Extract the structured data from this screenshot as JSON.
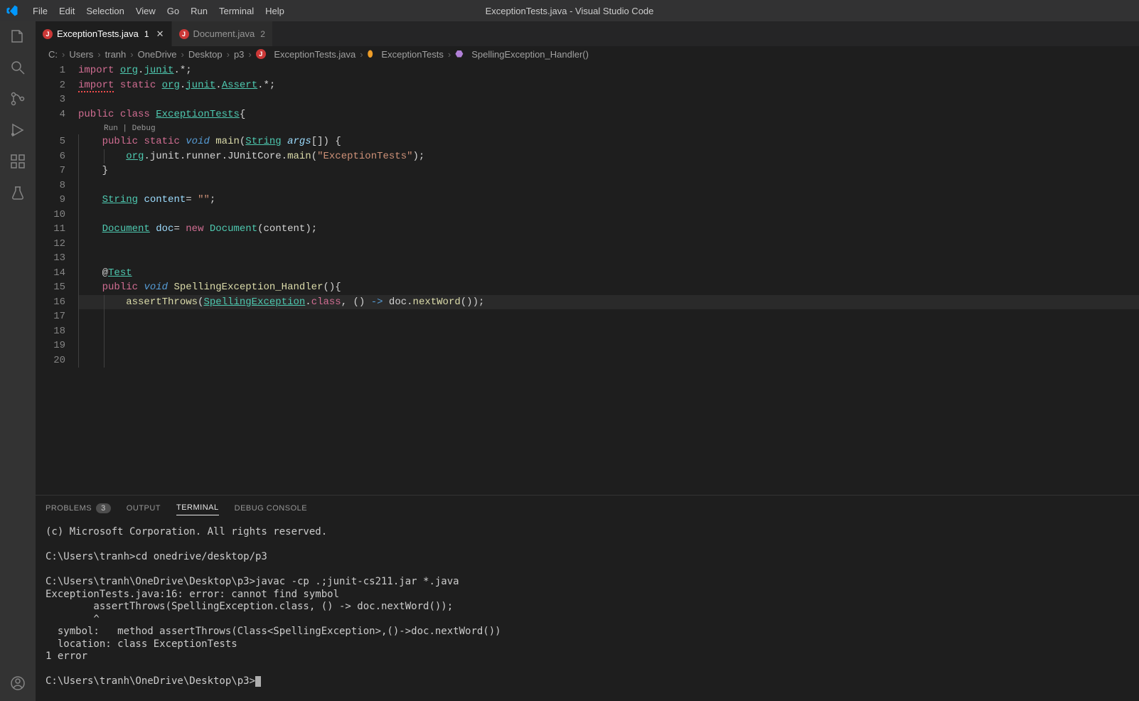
{
  "window": {
    "title": "ExceptionTests.java - Visual Studio Code"
  },
  "menu": {
    "items": [
      "File",
      "Edit",
      "Selection",
      "View",
      "Go",
      "Run",
      "Terminal",
      "Help"
    ]
  },
  "tabs": [
    {
      "label": "ExceptionTests.java",
      "modified": "1",
      "active": true,
      "close": true
    },
    {
      "label": "Document.java",
      "modified": "2",
      "active": false,
      "close": false
    }
  ],
  "breadcrumbs": {
    "parts": [
      "C:",
      "Users",
      "tranh",
      "OneDrive",
      "Desktop",
      "p3"
    ],
    "file": "ExceptionTests.java",
    "class": "ExceptionTests",
    "method": "SpellingException_Handler()"
  },
  "code": {
    "codelens": "Run | Debug",
    "lines": [
      "1",
      "2",
      "3",
      "4",
      "5",
      "6",
      "7",
      "8",
      "9",
      "10",
      "11",
      "12",
      "13",
      "14",
      "15",
      "16",
      "17",
      "18",
      "19",
      "20"
    ]
  },
  "panel": {
    "tabs": {
      "problems": "PROBLEMS",
      "problems_count": "3",
      "output": "OUTPUT",
      "terminal": "TERMINAL",
      "debug": "DEBUG CONSOLE"
    },
    "terminal_text": "(c) Microsoft Corporation. All rights reserved.\n\nC:\\Users\\tranh>cd onedrive/desktop/p3\n\nC:\\Users\\tranh\\OneDrive\\Desktop\\p3>javac -cp .;junit-cs211.jar *.java\nExceptionTests.java:16: error: cannot find symbol\n        assertThrows(SpellingException.class, () -> doc.nextWord());\n        ^\n  symbol:   method assertThrows(Class<SpellingException>,()->doc.nextWord())\n  location: class ExceptionTests\n1 error\n\nC:\\Users\\tranh\\OneDrive\\Desktop\\p3>"
  }
}
